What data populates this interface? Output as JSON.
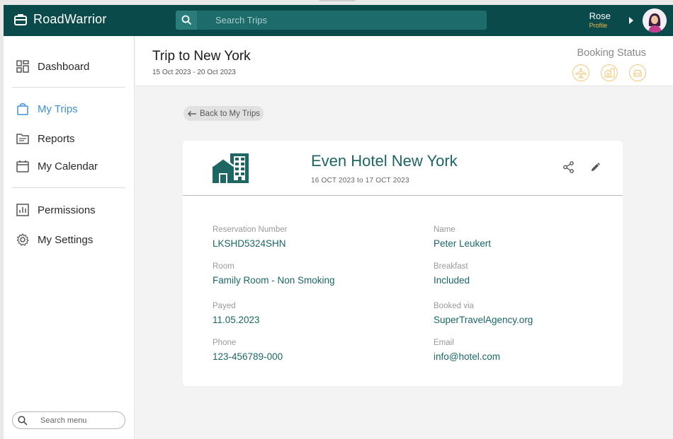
{
  "app": {
    "name": "RoadWarrior"
  },
  "search": {
    "placeholder": "Search Trips"
  },
  "user": {
    "name": "Rose",
    "role": "Profile"
  },
  "sidebar": {
    "items": [
      {
        "label": "Dashboard",
        "icon": "dashboard-icon"
      },
      {
        "label": "My Trips",
        "icon": "bag-icon",
        "active": true
      },
      {
        "label": "Reports",
        "icon": "folder-icon"
      },
      {
        "label": "My Calendar",
        "icon": "calendar-icon"
      },
      {
        "label": "Permissions",
        "icon": "chart-icon"
      },
      {
        "label": "My Settings",
        "icon": "gear-icon"
      }
    ],
    "search_placeholder": "Search menu"
  },
  "trip": {
    "title": "Trip to New York",
    "dates": "15 Oct 2023 - 20 Oct 2023",
    "booking_status_label": "Booking Status",
    "status_icons": [
      "plane-icon",
      "hotel-icon",
      "car-icon"
    ]
  },
  "back_link": "Back to My Trips",
  "hotel": {
    "name": "Even Hotel New York",
    "dates": "16 OCT 2023 to 17 OCT 2023",
    "fields": {
      "reservation_number": {
        "label": "Reservation Number",
        "value": "LKSHD5324SHN"
      },
      "name": {
        "label": "Name",
        "value": "Peter Leukert"
      },
      "room": {
        "label": "Room",
        "value": "Family Room - Non Smoking"
      },
      "breakfast": {
        "label": "Breakfast",
        "value": "Included"
      },
      "payed": {
        "label": "Payed",
        "value": "11.05.2023"
      },
      "booked_via": {
        "label": "Booked via",
        "value": "SuperTravelAgency.org"
      },
      "phone": {
        "label": "Phone",
        "value": "123-456789-000"
      },
      "email": {
        "label": "Email",
        "value": "info@hotel.com"
      }
    }
  },
  "colors": {
    "topbar": "#0b4a4a",
    "accent_teal": "#1e6664",
    "active_nav": "#3f8fd6",
    "status_outline": "#f2c97a"
  }
}
